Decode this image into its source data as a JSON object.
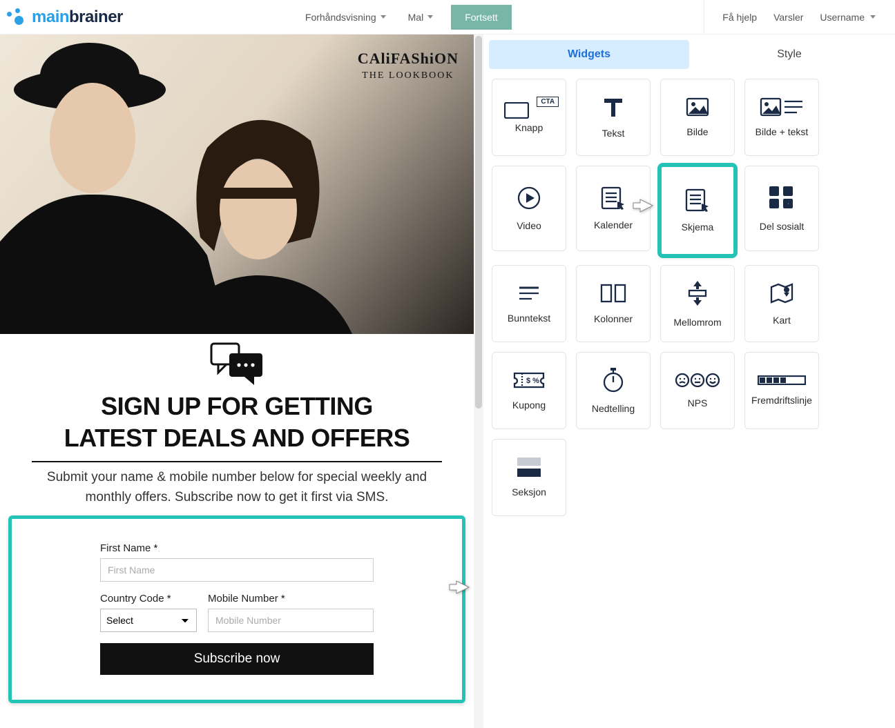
{
  "brand": {
    "part1": "main",
    "part2": "brainer"
  },
  "topbar": {
    "preview": "Forhåndsvisning",
    "template": "Mal",
    "continue": "Fortsett",
    "help": "Få hjelp",
    "alerts": "Varsler",
    "username": "Username"
  },
  "hero": {
    "line1": "CAliFAShiON",
    "line2": "THE LOOKBOOK"
  },
  "signup": {
    "title_l1": "SIGN UP FOR GETTING",
    "title_l2": "LATEST DEALS AND OFFERS",
    "sub": "Submit your name & mobile number below for special weekly and monthly offers. Subscribe now to get it first via SMS."
  },
  "form": {
    "first_name_label": "First Name",
    "first_name_ph": "First Name",
    "country_label": "Country Code",
    "country_ph": "Select",
    "mobile_label": "Mobile Number",
    "mobile_ph": "Mobile Number",
    "submit": "Subscribe now"
  },
  "panel": {
    "tab_widgets": "Widgets",
    "tab_style": "Style"
  },
  "widgets": {
    "knapp": "Knapp",
    "tekst": "Tekst",
    "bilde": "Bilde",
    "bilde_tekst": "Bilde + tekst",
    "video": "Video",
    "kalender": "Kalender",
    "skjema": "Skjema",
    "del": "Del sosialt",
    "bunntekst": "Bunntekst",
    "kolonner": "Kolonner",
    "mellomrom": "Mellomrom",
    "kart": "Kart",
    "kupong": "Kupong",
    "nedtelling": "Nedtelling",
    "nps": "NPS",
    "fremdrift": "Fremdriftslinje",
    "seksjon": "Seksjon",
    "cta": "CTA"
  }
}
